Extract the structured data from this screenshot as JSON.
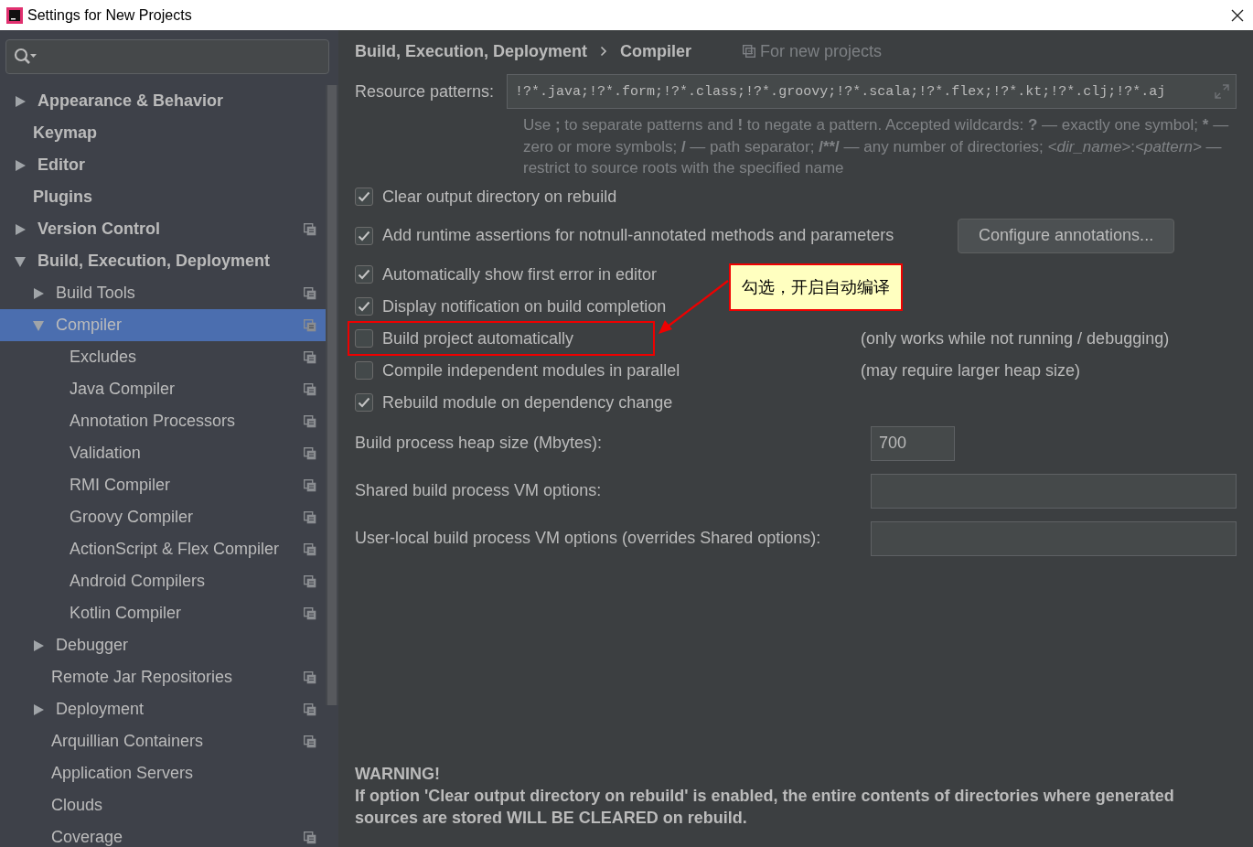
{
  "window": {
    "title": "Settings for New Projects"
  },
  "sidebar": {
    "tree": [
      {
        "label": "Appearance & Behavior",
        "expanded": false,
        "selected": false,
        "per_project": false
      },
      {
        "label": "Keymap",
        "selected": false,
        "per_project": false
      },
      {
        "label": "Editor",
        "expanded": false,
        "selected": false,
        "per_project": false
      },
      {
        "label": "Plugins",
        "selected": false,
        "per_project": false
      },
      {
        "label": "Version Control",
        "expanded": false,
        "selected": false,
        "per_project": true
      },
      {
        "label": "Build, Execution, Deployment",
        "expanded": true,
        "selected": false,
        "per_project": false,
        "children": [
          {
            "label": "Build Tools",
            "expanded": false,
            "selected": false,
            "per_project": true
          },
          {
            "label": "Compiler",
            "expanded": true,
            "selected": true,
            "per_project": true,
            "children": [
              {
                "label": "Excludes",
                "selected": false,
                "per_project": true
              },
              {
                "label": "Java Compiler",
                "selected": false,
                "per_project": true
              },
              {
                "label": "Annotation Processors",
                "selected": false,
                "per_project": true
              },
              {
                "label": "Validation",
                "selected": false,
                "per_project": true
              },
              {
                "label": "RMI Compiler",
                "selected": false,
                "per_project": true
              },
              {
                "label": "Groovy Compiler",
                "selected": false,
                "per_project": true
              },
              {
                "label": "ActionScript & Flex Compiler",
                "selected": false,
                "per_project": true
              },
              {
                "label": "Android Compilers",
                "selected": false,
                "per_project": true
              },
              {
                "label": "Kotlin Compiler",
                "selected": false,
                "per_project": true
              }
            ]
          },
          {
            "label": "Debugger",
            "expanded": false,
            "selected": false,
            "per_project": false
          },
          {
            "label": "Remote Jar Repositories",
            "selected": false,
            "per_project": true
          },
          {
            "label": "Deployment",
            "expanded": false,
            "selected": false,
            "per_project": true
          },
          {
            "label": "Arquillian Containers",
            "selected": false,
            "per_project": true
          },
          {
            "label": "Application Servers",
            "selected": false,
            "per_project": false
          },
          {
            "label": "Clouds",
            "selected": false,
            "per_project": false
          },
          {
            "label": "Coverage",
            "selected": false,
            "per_project": true
          }
        ]
      }
    ]
  },
  "breadcrumb": [
    "Build, Execution, Deployment",
    "Compiler"
  ],
  "scope_label": "For new projects",
  "resource_patterns": {
    "label": "Resource patterns:",
    "value": "!?*.java;!?*.form;!?*.class;!?*.groovy;!?*.scala;!?*.flex;!?*.kt;!?*.clj;!?*.aj",
    "hint": [
      {
        "kind": "plain",
        "text": "Use "
      },
      {
        "kind": "bold",
        "text": ";"
      },
      {
        "kind": "plain",
        "text": " to separate patterns and "
      },
      {
        "kind": "bold",
        "text": "!"
      },
      {
        "kind": "plain",
        "text": " to negate a pattern. Accepted wildcards: "
      },
      {
        "kind": "bold",
        "text": "?"
      },
      {
        "kind": "plain",
        "text": " — exactly one symbol; "
      },
      {
        "kind": "bold",
        "text": "*"
      },
      {
        "kind": "plain",
        "text": " — zero or more symbols; "
      },
      {
        "kind": "bold",
        "text": "/"
      },
      {
        "kind": "plain",
        "text": " — path separator; "
      },
      {
        "kind": "bold",
        "text": "/**/"
      },
      {
        "kind": "plain",
        "text": " — any number of directories; "
      },
      {
        "kind": "italic",
        "text": "<dir_name>"
      },
      {
        "kind": "plain",
        "text": ":"
      },
      {
        "kind": "italic",
        "text": "<pattern>"
      },
      {
        "kind": "plain",
        "text": " — restrict to source roots with the specified name"
      }
    ]
  },
  "options": [
    {
      "label": "Clear output directory on rebuild",
      "checked": true
    },
    {
      "label": "Add runtime assertions for notnull-annotated methods and parameters",
      "checked": true,
      "button": "Configure annotations..."
    },
    {
      "label": "Automatically show first error in editor",
      "checked": true
    },
    {
      "label": "Display notification on build completion",
      "checked": true
    },
    {
      "label": "Build project automatically",
      "checked": false,
      "note": "(only works while not running / debugging)",
      "highlighted": true
    },
    {
      "label": "Compile independent modules in parallel",
      "checked": false,
      "note": "(may require larger heap size)"
    },
    {
      "label": "Rebuild module on dependency change",
      "checked": true
    }
  ],
  "fields": [
    {
      "label": "Build process heap size (Mbytes):",
      "value": "700",
      "kind": "short"
    },
    {
      "label": "Shared build process VM options:",
      "kind": "wide"
    },
    {
      "label": "User-local build process VM options (overrides Shared options):",
      "kind": "wide"
    }
  ],
  "callout": {
    "text": "勾选，开启自动编译"
  },
  "warning": {
    "title": "WARNING!",
    "text": "If option 'Clear output directory on rebuild' is enabled, the entire contents of directories where generated sources are stored WILL BE CLEARED on rebuild."
  }
}
